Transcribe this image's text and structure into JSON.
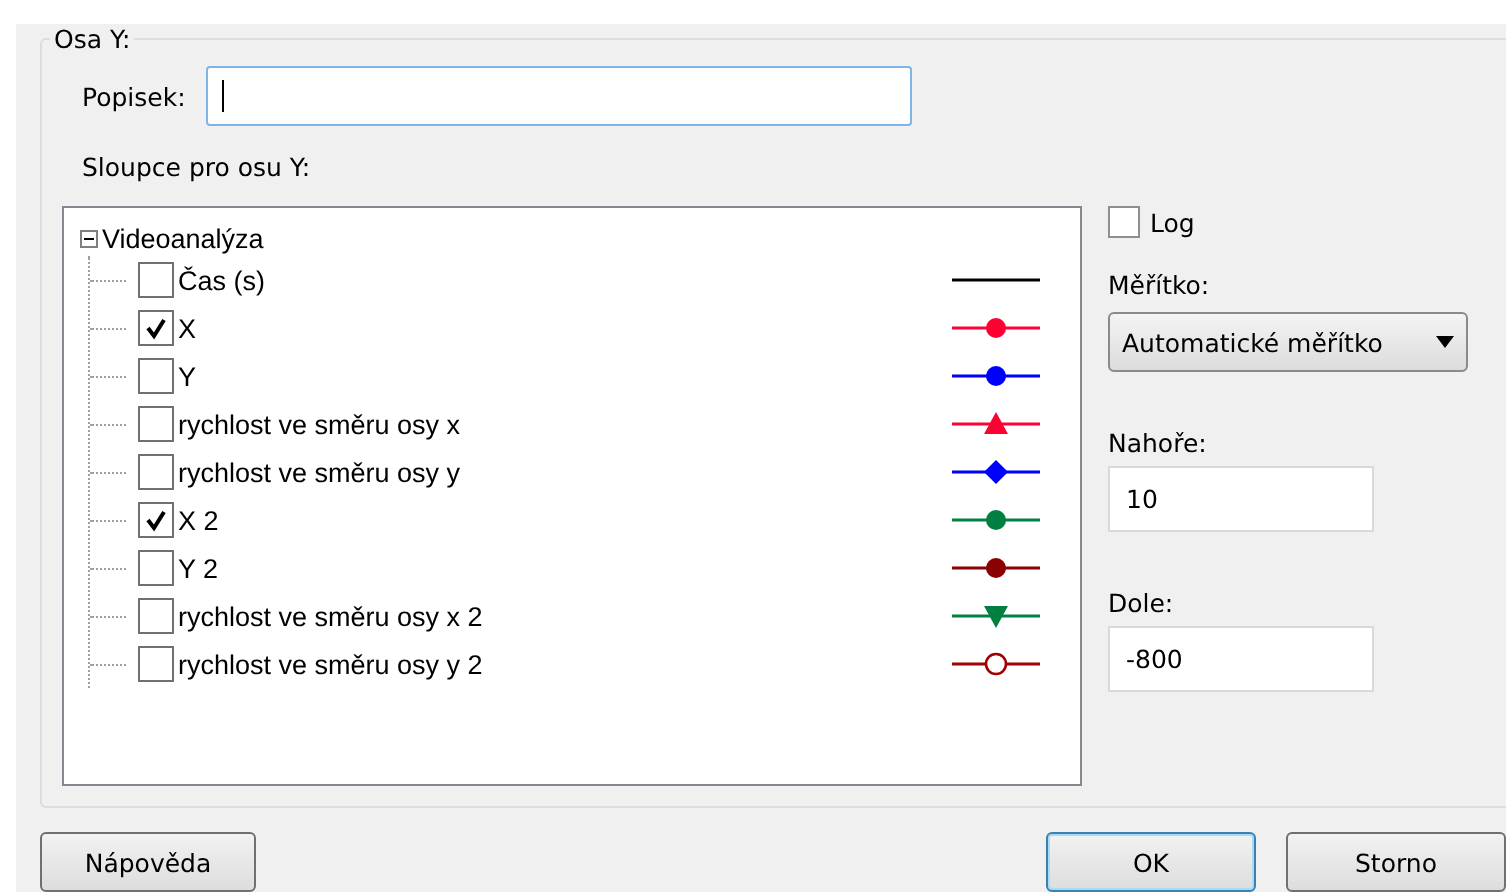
{
  "group": {
    "title": "Osa Y:"
  },
  "caption_field": {
    "label": "Popisek:"
  },
  "columns_label": "Sloupce pro osu Y:",
  "tree": {
    "label": "Videoanalýza",
    "expanded": true,
    "children": [
      {
        "label": "Čas (s)",
        "checked": false,
        "kind": "line",
        "color": "#000000"
      },
      {
        "label": "X",
        "checked": true,
        "kind": "circle",
        "color": "#ff0033"
      },
      {
        "label": "Y",
        "checked": false,
        "kind": "circle",
        "color": "#0000ff"
      },
      {
        "label": "rychlost ve směru osy x",
        "checked": false,
        "kind": "triangle",
        "color": "#ff0033"
      },
      {
        "label": "rychlost ve směru osy y",
        "checked": false,
        "kind": "diamond",
        "color": "#0000ff"
      },
      {
        "label": "X 2",
        "checked": true,
        "kind": "circle",
        "color": "#008040"
      },
      {
        "label": "Y 2",
        "checked": false,
        "kind": "circle",
        "color": "#8b0000"
      },
      {
        "label": "rychlost ve směru osy x 2",
        "checked": false,
        "kind": "invtriangle",
        "color": "#008040"
      },
      {
        "label": "rychlost ve směru osy y 2",
        "checked": false,
        "kind": "ring",
        "color": "#a00000"
      }
    ]
  },
  "log": {
    "label": "Log",
    "checked": false
  },
  "scale": {
    "label": "Měřítko:",
    "value": "Automatické měřítko"
  },
  "top": {
    "label": "Nahoře:",
    "value": "10"
  },
  "bottom": {
    "label": "Dole:",
    "value": "-800"
  },
  "buttons": [
    {
      "label": "Nápověda",
      "kind": "help"
    },
    {
      "label": "OK",
      "kind": "default"
    },
    {
      "label": "Storno",
      "kind": "normal"
    }
  ]
}
